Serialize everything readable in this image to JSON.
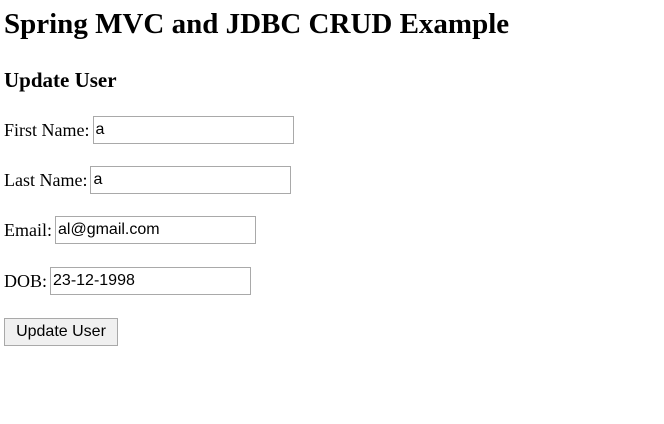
{
  "page": {
    "title": "Spring MVC and JDBC CRUD Example",
    "subtitle": "Update User"
  },
  "form": {
    "first_name": {
      "label": "First Name:",
      "value": "a"
    },
    "last_name": {
      "label": "Last Name:",
      "value": "a"
    },
    "email": {
      "label": "Email:",
      "value": "al@gmail.com"
    },
    "dob": {
      "label": "DOB:",
      "value": "23-12-1998"
    },
    "submit_label": "Update User"
  }
}
